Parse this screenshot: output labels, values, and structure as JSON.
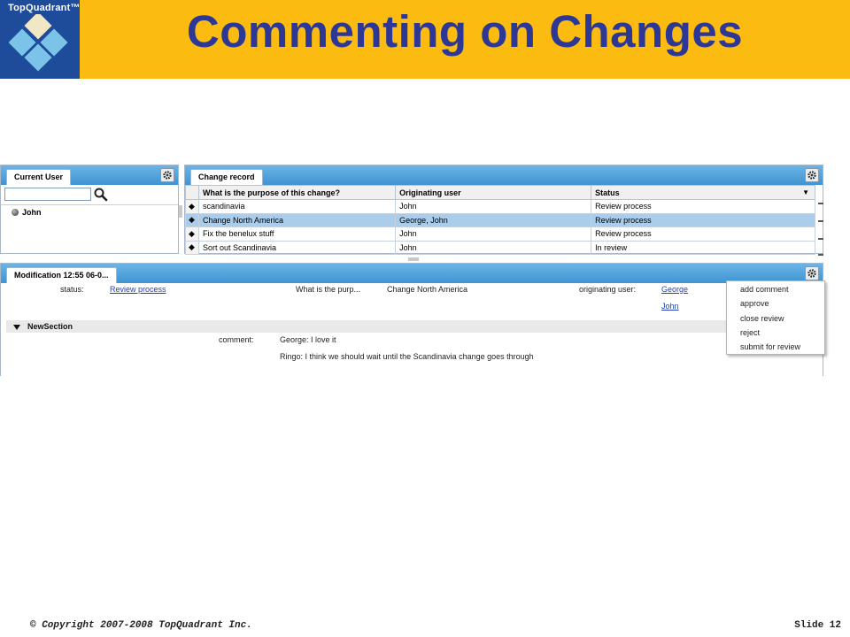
{
  "slide": {
    "title": "Commenting on Changes",
    "logo_text": "TopQuadrant™",
    "copyright": "© Copyright 2007-2008 TopQuadrant Inc.",
    "slide_number": "Slide 12"
  },
  "current_user_panel": {
    "tab": "Current User",
    "search_placeholder": "",
    "users": [
      "John"
    ]
  },
  "change_record_panel": {
    "tab": "Change record",
    "columns": [
      "What is the purpose of this change?",
      "Originating user",
      "Status"
    ],
    "rows": [
      {
        "purpose": "scandinavia",
        "user": "John",
        "status": "Review process"
      },
      {
        "purpose": "Change North America",
        "user": "George, John",
        "status": "Review process"
      },
      {
        "purpose": "Fix the benelux stuff",
        "user": "John",
        "status": "Review process"
      },
      {
        "purpose": "Sort out Scandinavia",
        "user": "John",
        "status": "In review"
      }
    ]
  },
  "modification_panel": {
    "tab": "Modification 12:55 06-0...",
    "status_label": "status:",
    "status_value": "Review process",
    "purpose_label": "What is the purp...",
    "purpose_value": "Change North America",
    "originating_label": "originating user:",
    "originating_users": [
      "George",
      "John"
    ],
    "section_title": "NewSection",
    "comment_label": "comment:",
    "comments": [
      "George: I love it",
      "Ringo: I think we should wait until the Scandinavia change goes through"
    ]
  },
  "context_menu": {
    "items": [
      "add comment",
      "approve",
      "close review",
      "reject",
      "submit for review"
    ]
  }
}
